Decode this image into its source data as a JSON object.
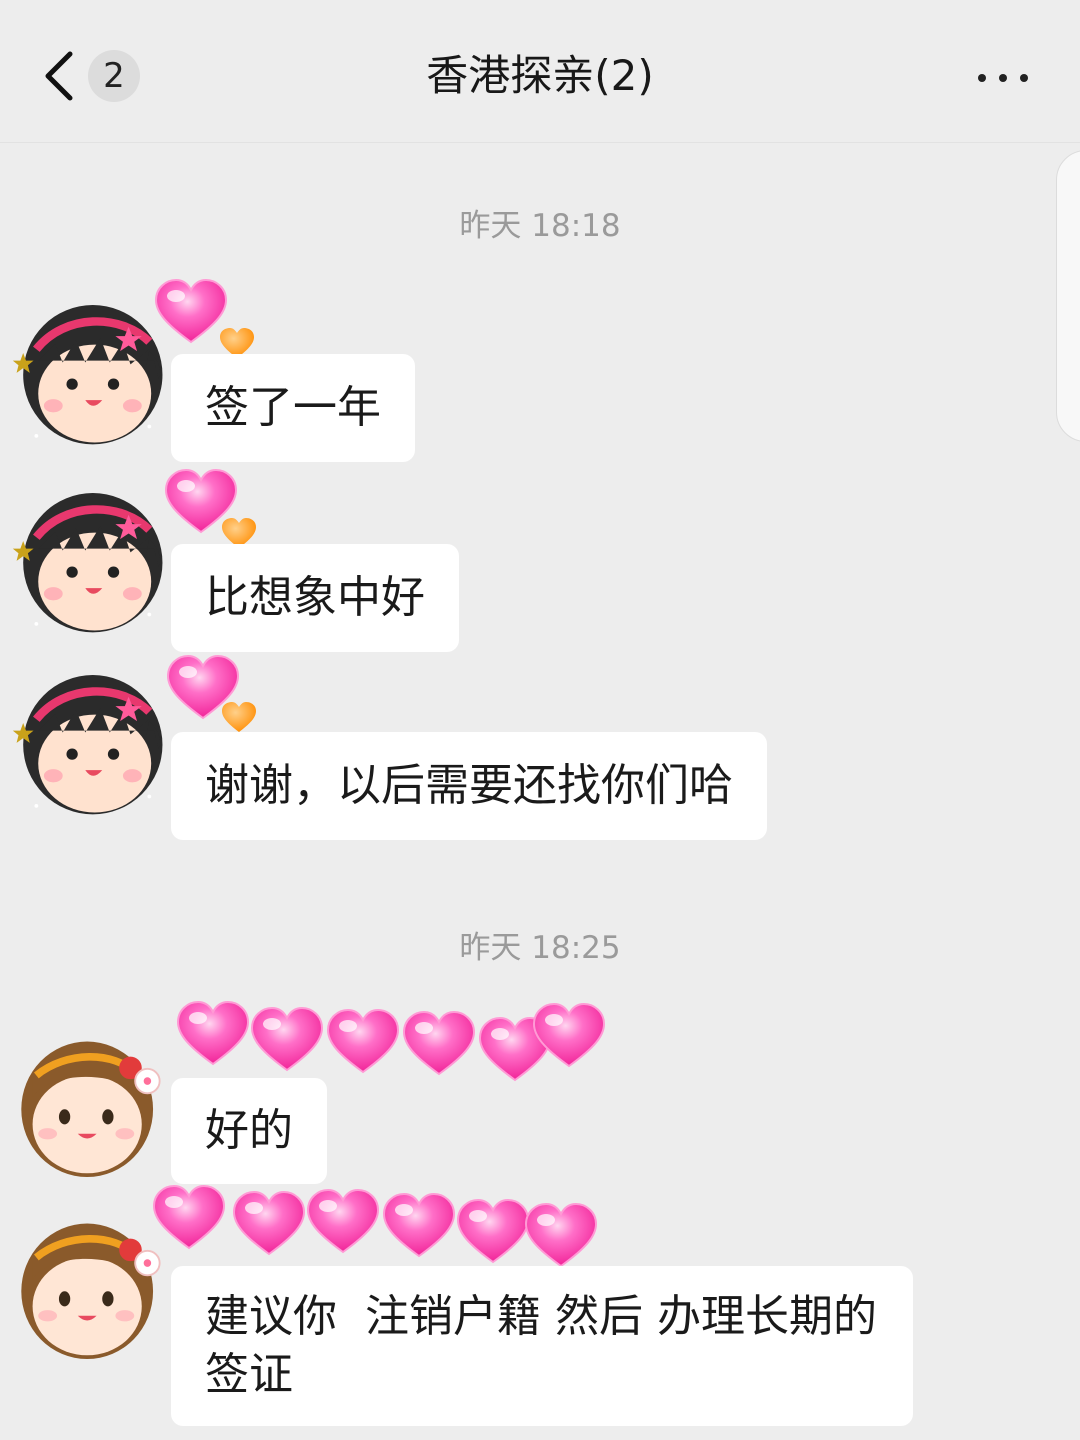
{
  "header": {
    "back_badge": "2",
    "title": "香港探亲(2)"
  },
  "timestamps": [
    "昨天 18:18",
    "昨天 18:25"
  ],
  "messages": [
    {
      "text": "签了一年"
    },
    {
      "text": "比想象中好"
    },
    {
      "text": "谢谢，以后需要还找你们哈"
    },
    {
      "text": "好的"
    },
    {
      "text": "建议你  注销户籍 然后 办理长期的\n签证"
    }
  ],
  "colors": {
    "background": "#ededed",
    "bubble": "#ffffff",
    "heart_pink": "#ff3fb0",
    "heart_orange": "#ff9a1a"
  }
}
